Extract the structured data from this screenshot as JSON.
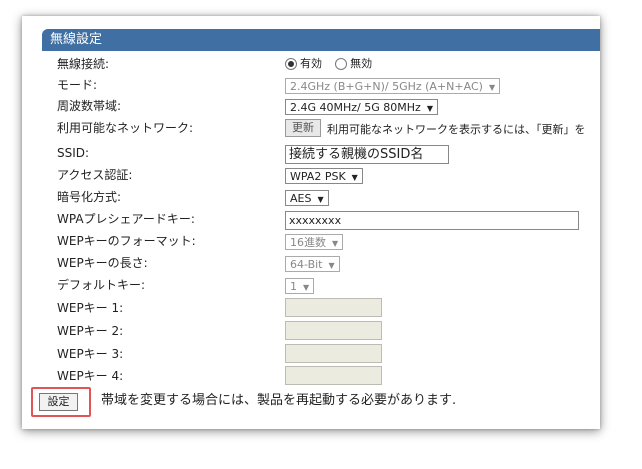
{
  "panel": {
    "title": "無線設定"
  },
  "rows": {
    "wireless": {
      "label": "無線接続:",
      "options": [
        "有効",
        "無効"
      ],
      "selected": "有効"
    },
    "mode": {
      "label": "モード:",
      "value": "2.4GHz (B+G+N)/ 5GHz (A+N+AC)"
    },
    "bandwidth": {
      "label": "周波数帯域:",
      "value": "2.4G 40MHz/ 5G 80MHz"
    },
    "networks": {
      "label": "利用可能なネットワーク:",
      "button": "更新",
      "note": "利用可能なネットワークを表示するには、「更新」を"
    },
    "ssid": {
      "label": "SSID:",
      "value": "接続する親機のSSID名"
    },
    "access_auth": {
      "label": "アクセス認証:",
      "value": "WPA2 PSK"
    },
    "encryption": {
      "label": "暗号化方式:",
      "value": "AES"
    },
    "wpa_key": {
      "label": "WPAプレシェアードキー:",
      "value": "xxxxxxxx"
    },
    "wep_format": {
      "label": "WEPキーのフォーマット:",
      "value": "16進数"
    },
    "wep_length": {
      "label": "WEPキーの長さ:",
      "value": "64-Bit"
    },
    "default_key": {
      "label": "デフォルトキー:",
      "value": "1"
    },
    "wep_key1": {
      "label": "WEPキー 1:"
    },
    "wep_key2": {
      "label": "WEPキー 2:"
    },
    "wep_key3": {
      "label": "WEPキー 3:"
    },
    "wep_key4": {
      "label": "WEPキー 4:"
    }
  },
  "footer": {
    "set_button": "設定",
    "note": "帯域を変更する場合には、製品を再起動する必要があります."
  },
  "colors": {
    "header_bg": "#3f6fa3",
    "highlight": "#e05555"
  }
}
